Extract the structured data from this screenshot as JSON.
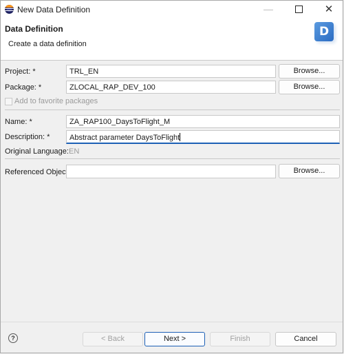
{
  "window": {
    "title": "New Data Definition",
    "minimize_glyph": "—",
    "close_glyph": "✕"
  },
  "banner": {
    "title": "Data Definition",
    "description": "Create a data definition",
    "icon_letter": "D"
  },
  "form": {
    "project": {
      "label": "Project: *",
      "value": "TRL_EN",
      "browse_label": "Browse..."
    },
    "package": {
      "label": "Package: *",
      "value": "ZLOCAL_RAP_DEV_100",
      "browse_label": "Browse..."
    },
    "favorites": {
      "label": "Add to favorite packages",
      "checked": false
    },
    "name": {
      "label": "Name: *",
      "value": "ZA_RAP100_DaysToFlight_M"
    },
    "description": {
      "label": "Description: *",
      "value": "Abstract parameter DaysToFlight"
    },
    "original_language": {
      "label": "Original Language:",
      "value": "EN"
    },
    "referenced_object": {
      "label": "Referenced Object:",
      "value": "",
      "browse_label": "Browse..."
    }
  },
  "footer": {
    "help_glyph": "?",
    "back_label": "< Back",
    "next_label": "Next >",
    "finish_label": "Finish",
    "cancel_label": "Cancel"
  },
  "colors": {
    "focus_accent": "#1b5fb5",
    "banner_icon": "#2a6bc2"
  }
}
